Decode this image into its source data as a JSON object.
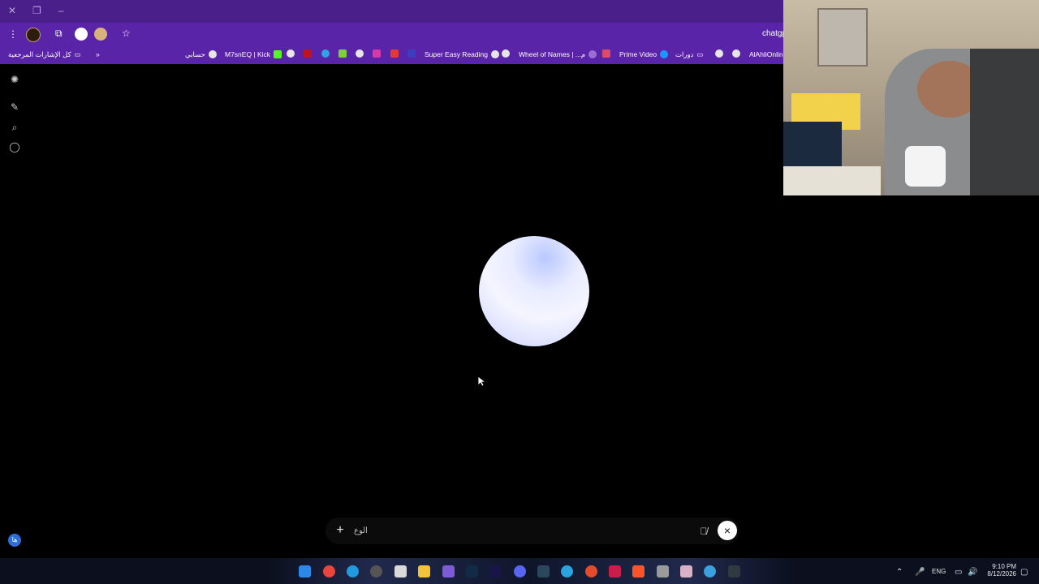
{
  "browser": {
    "url_partial": "chatgp",
    "bookmarks": [
      {
        "label": "كل الإشارات المرجعية"
      },
      {
        "label": "حسابي"
      },
      {
        "label": "M7snEQ | Kick"
      },
      {
        "label": "Super Easy Reading"
      },
      {
        "label": "Wheel of Names | ...م"
      },
      {
        "label": "Prime Video"
      },
      {
        "label": "دورات"
      },
      {
        "label": "AlAhliOnline"
      }
    ],
    "overflow_label": "»"
  },
  "voice": {
    "input_text": "الوع",
    "plus_label": "+",
    "close_label": "×"
  },
  "taskbar": {
    "lang": "ENG",
    "time": "9:10 PM",
    "date": "8/12/2026"
  },
  "sidebar": {
    "avatar_label": "ها"
  },
  "colors": {
    "chrome_bg": "#5a24a8",
    "titlebar_bg": "#4b1f8a",
    "orb": "#e9ecff"
  }
}
